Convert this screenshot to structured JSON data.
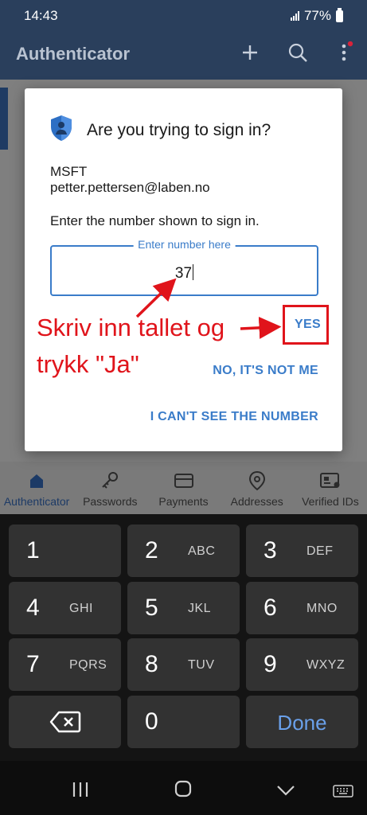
{
  "status_bar": {
    "time": "14:43",
    "battery": "77%"
  },
  "app_bar": {
    "title": "Authenticator",
    "icons": [
      "plus-icon",
      "search-icon",
      "more-vert-icon"
    ],
    "notification_dot_color": "#d8233a"
  },
  "dialog": {
    "title": "Are you trying to sign in?",
    "org": "MSFT",
    "account": "petter.pettersen@laben.no",
    "instruction": "Enter the number shown to sign in.",
    "field_label": "Enter number here",
    "field_value": "37",
    "yes_label": "YES",
    "no_label": "NO, IT'S NOT ME",
    "cant_see_label": "I CAN'T SEE THE NUMBER",
    "accent_color": "#3a7cc9"
  },
  "annotation": {
    "line1": "Skriv inn tallet og",
    "line2": "trykk \"Ja\"",
    "color": "#e0141b"
  },
  "bottom_nav": {
    "items": [
      {
        "label": "Authenticator",
        "icon": "lock-icon",
        "active": true
      },
      {
        "label": "Passwords",
        "icon": "key-icon",
        "active": false
      },
      {
        "label": "Payments",
        "icon": "card-icon",
        "active": false
      },
      {
        "label": "Addresses",
        "icon": "location-pin-icon",
        "active": false
      },
      {
        "label": "Verified IDs",
        "icon": "id-card-icon",
        "active": false
      }
    ]
  },
  "keypad": {
    "keys": [
      {
        "num": "1",
        "letters": ""
      },
      {
        "num": "2",
        "letters": "ABC"
      },
      {
        "num": "3",
        "letters": "DEF"
      },
      {
        "num": "4",
        "letters": "GHI"
      },
      {
        "num": "5",
        "letters": "JKL"
      },
      {
        "num": "6",
        "letters": "MNO"
      },
      {
        "num": "7",
        "letters": "PQRS"
      },
      {
        "num": "8",
        "letters": "TUV"
      },
      {
        "num": "9",
        "letters": "WXYZ"
      },
      {
        "num": "0",
        "letters": ""
      }
    ],
    "done_label": "Done"
  },
  "system_nav": {
    "icons": [
      "recents-icon",
      "home-icon",
      "hide-keyboard-icon",
      "keyboard-icon"
    ]
  }
}
